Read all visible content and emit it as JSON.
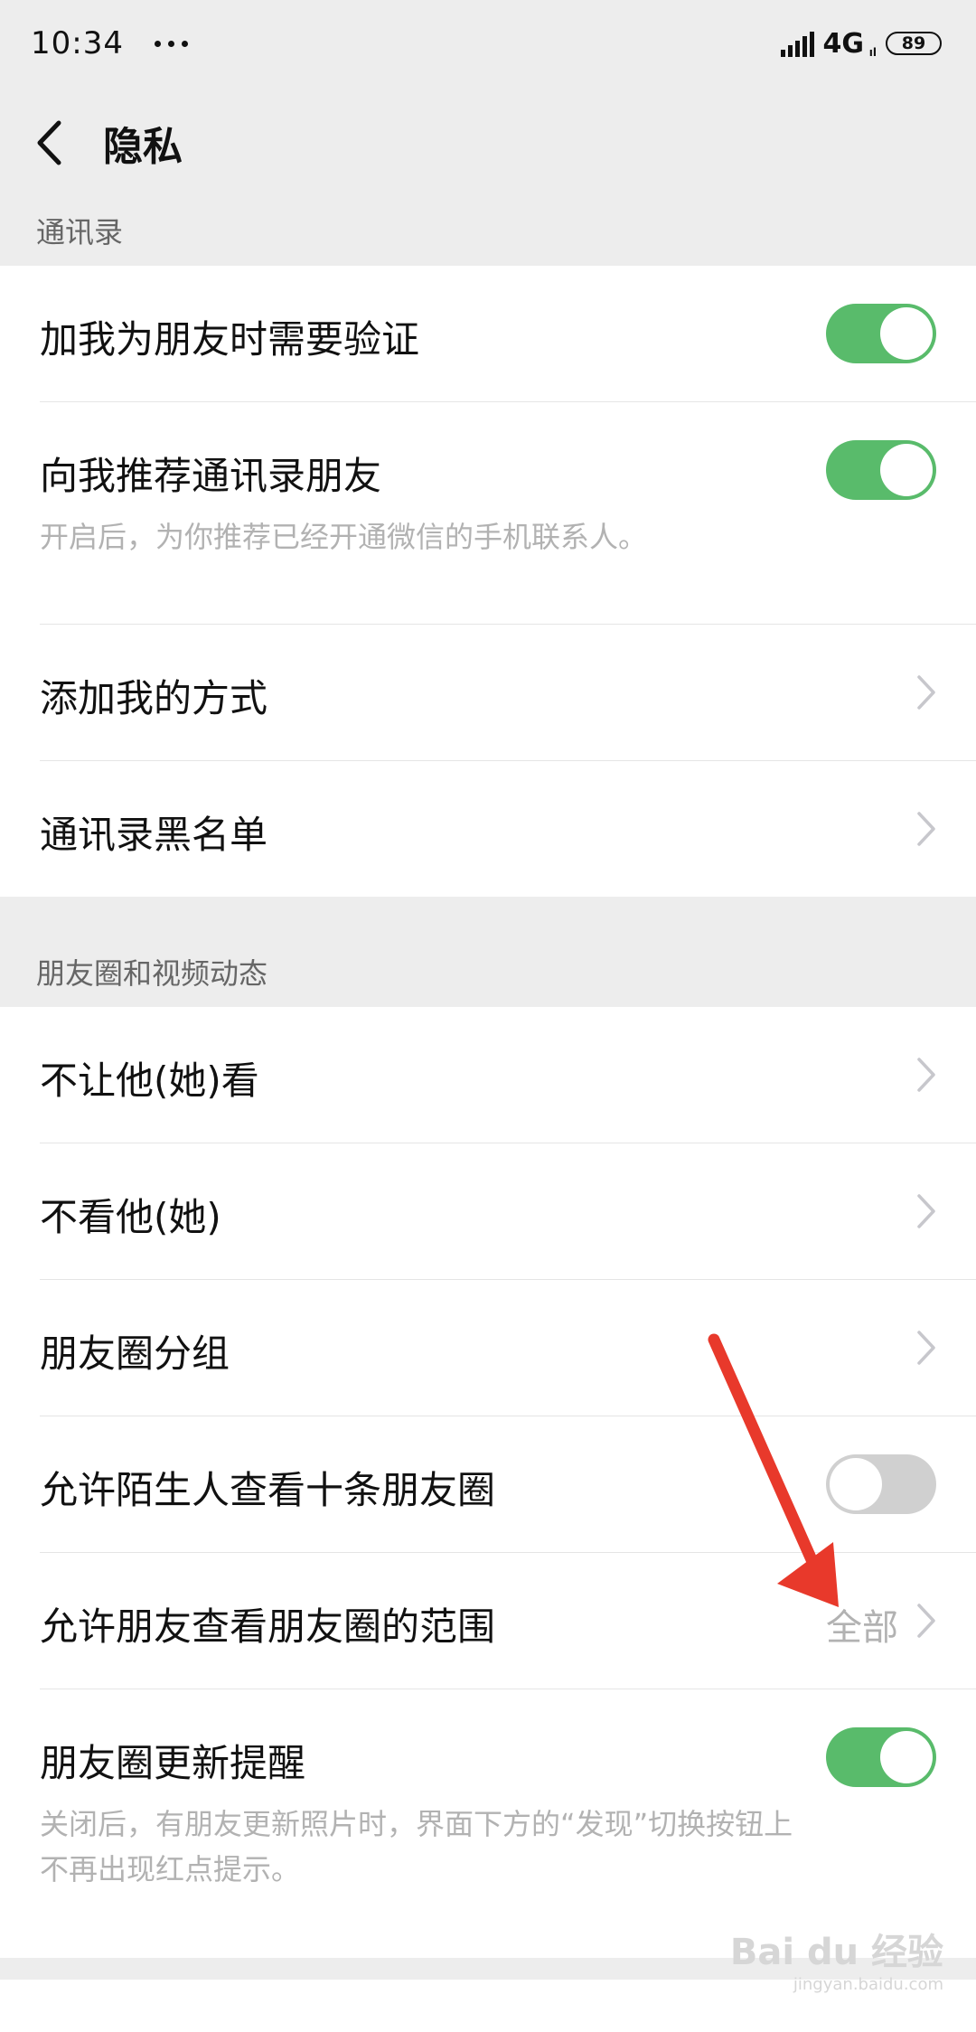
{
  "status_bar": {
    "time": "10:34",
    "network": "4G",
    "network_sub": "ıl",
    "battery": "89"
  },
  "header": {
    "title": "隐私"
  },
  "sections": [
    {
      "label": "通讯录",
      "rows": [
        {
          "title": "加我为朋友时需要验证",
          "control": "toggle",
          "state": "on"
        },
        {
          "title": "向我推荐通讯录朋友",
          "control": "toggle",
          "state": "on",
          "description": "开启后，为你推荐已经开通微信的手机联系人。"
        },
        {
          "title": "添加我的方式",
          "control": "chevron"
        },
        {
          "title": "通讯录黑名单",
          "control": "chevron"
        }
      ]
    },
    {
      "label": "朋友圈和视频动态",
      "rows": [
        {
          "title": "不让他(她)看",
          "control": "chevron"
        },
        {
          "title": "不看他(她)",
          "control": "chevron"
        },
        {
          "title": "朋友圈分组",
          "control": "chevron"
        },
        {
          "title": "允许陌生人查看十条朋友圈",
          "control": "toggle",
          "state": "off"
        },
        {
          "title": "允许朋友查看朋友圈的范围",
          "control": "chevron",
          "value": "全部"
        },
        {
          "title": "朋友圈更新提醒",
          "control": "toggle",
          "state": "on",
          "description_lines": [
            "关闭后，有朋友更新照片时，界面下方的“发现”切换按钮上",
            "不再出现红点提示。"
          ]
        }
      ]
    }
  ],
  "annotation": {
    "arrow_color": "#e8392b"
  },
  "watermark": {
    "brand": "Bai du 经验",
    "site": "jingyan.baidu.com"
  },
  "colors": {
    "toggle_on": "#59bb6b",
    "toggle_off": "#d0d0d0",
    "background": "#ededed"
  }
}
